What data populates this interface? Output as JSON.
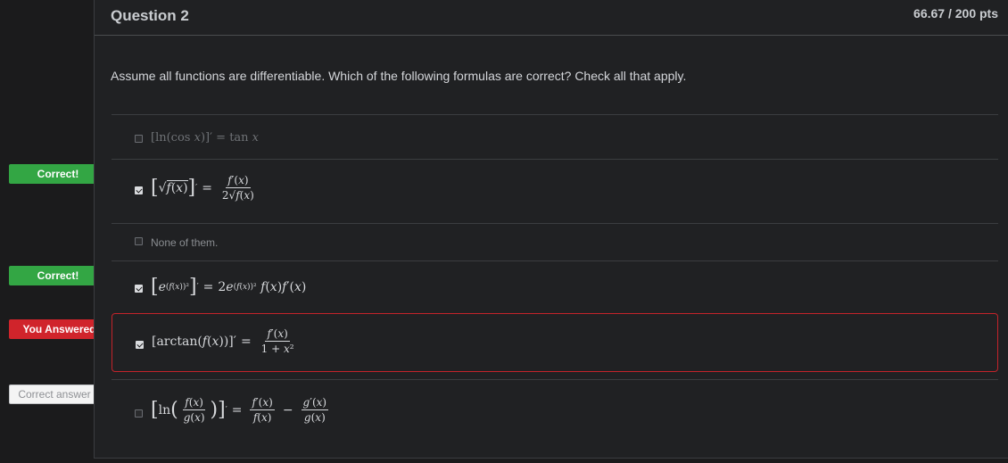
{
  "question": {
    "title": "Question 2",
    "points": "66.67 / 200 pts",
    "prompt": "Assume all functions are differentiable. Which of the following formulas are correct?  Check all that apply."
  },
  "answers": [
    {
      "id": "a1",
      "formula": "[ln(cos x)]′ = tan x",
      "checked": false
    },
    {
      "id": "a2",
      "formula": "[√f(x)]′ = f′(x) / 2√f(x)",
      "checked": true,
      "tag": "Correct!"
    },
    {
      "id": "a3",
      "label": "None of them.",
      "checked": false
    },
    {
      "id": "a4",
      "formula": "[e^(f(x))²]′ = 2e^(f(x))² f(x)f′(x)",
      "checked": true,
      "tag": "Correct!"
    },
    {
      "id": "a5",
      "formula": "[arctan(f(x))]′ = f′(x) / (1 + x²)",
      "checked": true,
      "tag": "You Answered"
    },
    {
      "id": "a6",
      "formula": "[ln(f(x)/g(x))]′ = f′(x)/f(x) − g′(x)/g(x)",
      "checked": false,
      "tag": "Correct answer"
    }
  ],
  "tags": {
    "correct1": "Correct!",
    "correct2": "Correct!",
    "you_answered": "You Answered",
    "correct_answer": "Correct answer"
  },
  "colors": {
    "correct": "#33a644",
    "wrong": "#d0242b",
    "background": "#202123"
  }
}
